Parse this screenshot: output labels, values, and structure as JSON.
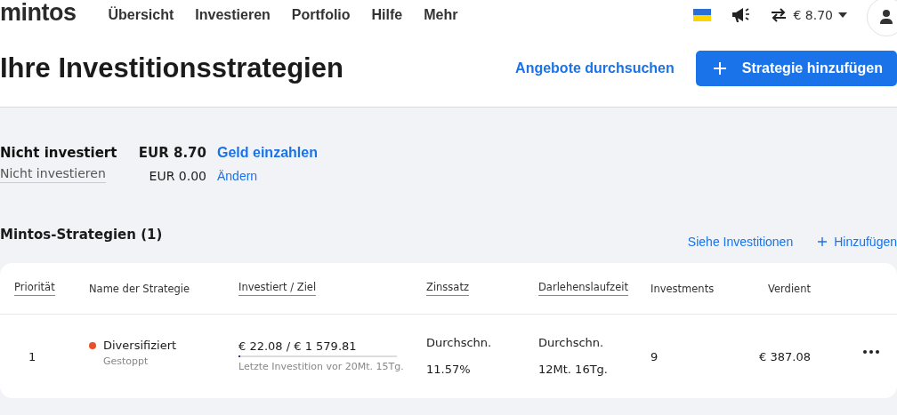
{
  "logo": "mintos",
  "nav": [
    {
      "label": "Übersicht",
      "selected": false
    },
    {
      "label": "Investieren",
      "selected": false
    },
    {
      "label": "Portfolio",
      "selected": false
    },
    {
      "label": "Hilfe",
      "selected": false
    },
    {
      "label": "Mehr",
      "selected": false
    }
  ],
  "account": {
    "balance": "€ 8.70"
  },
  "page_title": "Ihre Investitionsstrategien",
  "browse_link": "Angebote durchsuchen",
  "add_button": "Strategie hinzufügen",
  "summary": [
    {
      "label": "Nicht investiert",
      "amount": "EUR 8.70",
      "action": "Geld einzahlen",
      "kind": "main"
    },
    {
      "label": "Nicht investieren",
      "amount": "EUR 0.00",
      "action": "Ändern",
      "kind": "sub"
    }
  ],
  "section": {
    "title": "Mintos-Strategien (1)",
    "links": [
      "Siehe Investitionen",
      "Hinzufügen"
    ]
  },
  "table": {
    "columns": [
      {
        "label": "Priorität",
        "underlined": true
      },
      {
        "label": "Name der Strategie",
        "underlined": false
      },
      {
        "label": "Investiert / Ziel",
        "underlined": true
      },
      {
        "label": "Zinssatz",
        "underlined": true
      },
      {
        "label": "Darlehenslaufzeit",
        "underlined": true
      },
      {
        "label": "Investments",
        "underlined": false
      },
      {
        "label": "Verdient",
        "underlined": false
      }
    ],
    "rows": [
      {
        "priority": "1",
        "name": "Diversifiziert",
        "color": "#e8502a",
        "status": "Gestoppt",
        "invested": "€ 22.08  /  € 1 579.81",
        "level": 0.014,
        "last_investment": "Letzte Investition vor 20Mt. 15Tg.",
        "rate_label": "Durchschn.",
        "rate": "11.57%",
        "term_label": "Durchschn.",
        "term": "12Mt. 16Tg.",
        "investments": "9",
        "earned": "€ 387.08"
      }
    ]
  }
}
